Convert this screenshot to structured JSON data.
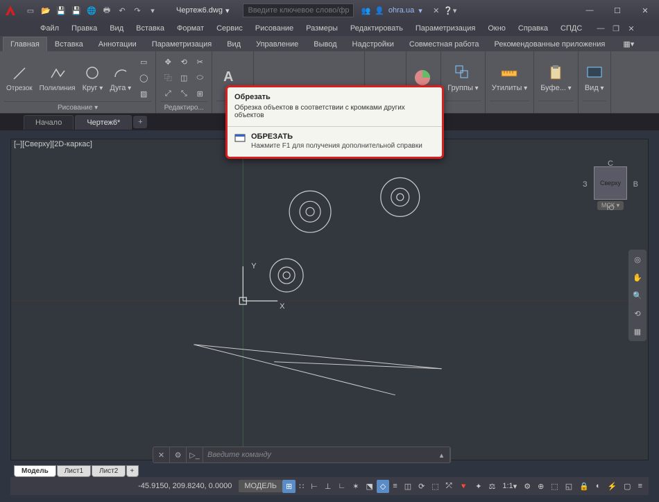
{
  "title": {
    "document": "Чертеж6.dwg",
    "search_placeholder": "Введите ключевое слово/фразу",
    "user": "ohra.ua"
  },
  "menu": [
    "Файл",
    "Правка",
    "Вид",
    "Вставка",
    "Формат",
    "Сервис",
    "Рисование",
    "Размеры",
    "Редактировать",
    "Параметризация",
    "Окно",
    "Справка",
    "СПДС"
  ],
  "ribbon_tabs": [
    "Главная",
    "Вставка",
    "Аннотации",
    "Параметризация",
    "Вид",
    "Управление",
    "Вывод",
    "Надстройки",
    "Совместная работа",
    "Рекомендованные приложения"
  ],
  "ribbon_active": 0,
  "panels": {
    "draw": {
      "title": "Рисование ▾",
      "items": {
        "line": "Отрезок",
        "polyline": "Полилиния",
        "circle": "Круг",
        "arc": "Дуга"
      }
    },
    "modify": {
      "title": "Редактиро..."
    },
    "groups": "Группы",
    "utilities": "Утилиты",
    "clipboard": "Буфе...",
    "view": "Вид"
  },
  "doctabs": {
    "start": "Начало",
    "doc": "Чертеж6*"
  },
  "viewport_label": "[–][Сверху][2D-каркас]",
  "axes": {
    "x": "X",
    "y": "Y"
  },
  "viewcube": {
    "n": "С",
    "s": "Ю",
    "w": "З",
    "e": "В",
    "face": "Сверху",
    "wcs": "МСК ▾"
  },
  "tooltip": {
    "title": "Обрезать",
    "desc": "Обрезка объектов в соответствии с кромками других объектов",
    "cmd": "ОБРЕЗАТЬ",
    "help": "Нажмите F1 для получения дополнительной справки"
  },
  "cmdline": {
    "placeholder": "Введите команду"
  },
  "layouts": {
    "model": "Модель",
    "sheet1": "Лист1",
    "sheet2": "Лист2"
  },
  "status": {
    "coords": "-45.9150, 209.8240, 0.0000",
    "model": "МОДЕЛЬ",
    "scale": "1:1"
  }
}
